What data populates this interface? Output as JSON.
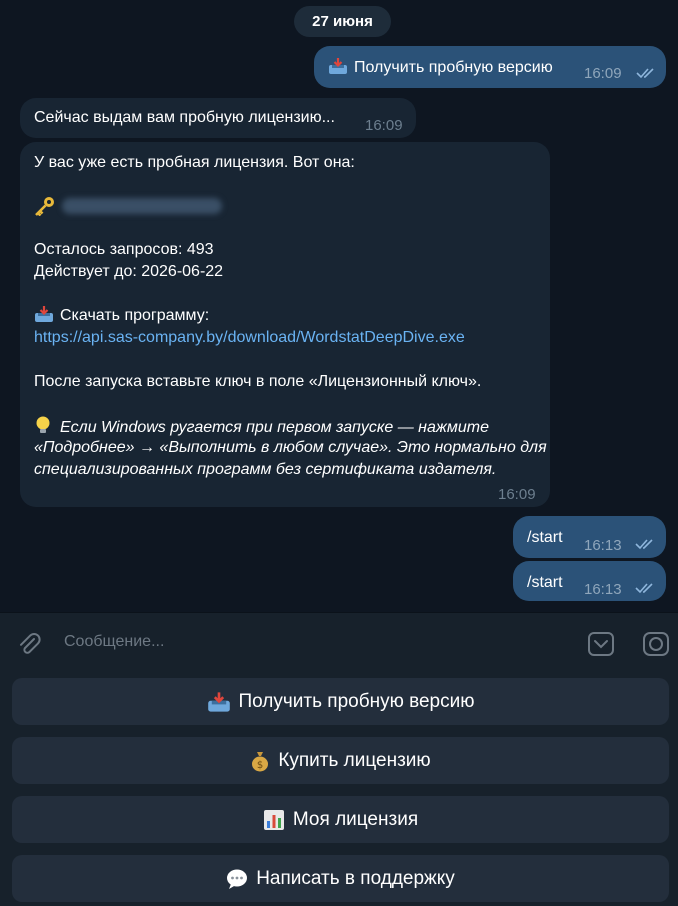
{
  "date_label": "27 июня",
  "messages": [
    {
      "side": "out",
      "icon": "inbox-tray-icon",
      "text": "Получить пробную версию",
      "time": "16:09"
    },
    {
      "side": "in",
      "text": "Сейчас выдам вам пробную лицензию...",
      "time": "16:09"
    },
    {
      "side": "in",
      "lines": {
        "intro": "У вас уже есть пробная лицензия. Вот она:",
        "key_hidden_note": "",
        "requests_left": "Осталось запросов: 493",
        "valid_until": "Действует до: 2026-06-22",
        "download_label": "Скачать программу:",
        "download_url": "https://api.sas-company.by/download/WordstatDeepDive.exe",
        "after_launch": "После запуска вставьте ключ в поле «Лицензионный ключ».",
        "tip_1": "Если Windows ругается при первом запуске — нажмите",
        "tip_2": "«Подробнее» → «Выполнить в любом случае». Это нормально для",
        "tip_3": "специализированных программ без сертификата издателя."
      },
      "time": "16:09"
    },
    {
      "side": "out",
      "text": "/start",
      "time": "16:13"
    },
    {
      "side": "out",
      "text": "/start",
      "time": "16:13"
    }
  ],
  "composer": {
    "placeholder": "Сообщение..."
  },
  "keyboard": [
    {
      "icon": "inbox-tray-icon",
      "label": "Получить пробную версию"
    },
    {
      "icon": "money-bag-icon",
      "label": "Купить лицензию"
    },
    {
      "icon": "bar-chart-icon",
      "label": "Моя лицензия"
    },
    {
      "icon": "speech-bubble-icon",
      "label": "Написать в поддержку"
    }
  ],
  "colors": {
    "background": "#0e1621",
    "outgoing": "#2b5278",
    "incoming": "#182533",
    "link": "#6ab3f3",
    "button": "#232e3c"
  }
}
